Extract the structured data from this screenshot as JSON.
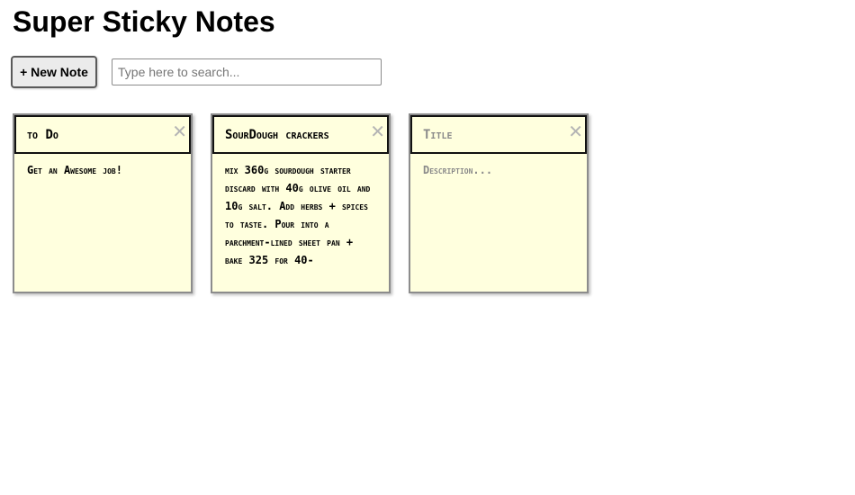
{
  "app": {
    "title": "Super Sticky Notes"
  },
  "controls": {
    "new_note_label": "+ New Note",
    "search_placeholder": "Type here to search...",
    "search_value": ""
  },
  "notes": [
    {
      "title": "to Do",
      "description": "Get an Awesome job!",
      "close_label": "✕"
    },
    {
      "title": "SourDough crackers",
      "description": "mix 360g sourdough starter discard with 40g olive oil and 10g salt. Add herbs + spices to taste. Pour into a parchment-lined sheet pan + bake 325 for 40-",
      "close_label": "✕"
    },
    {
      "title": "",
      "title_placeholder": "Title",
      "description": "",
      "description_placeholder": "Description...",
      "close_label": "✕"
    }
  ],
  "colors": {
    "note_background": "#ffffde",
    "close_icon": "#b4b4b4"
  }
}
